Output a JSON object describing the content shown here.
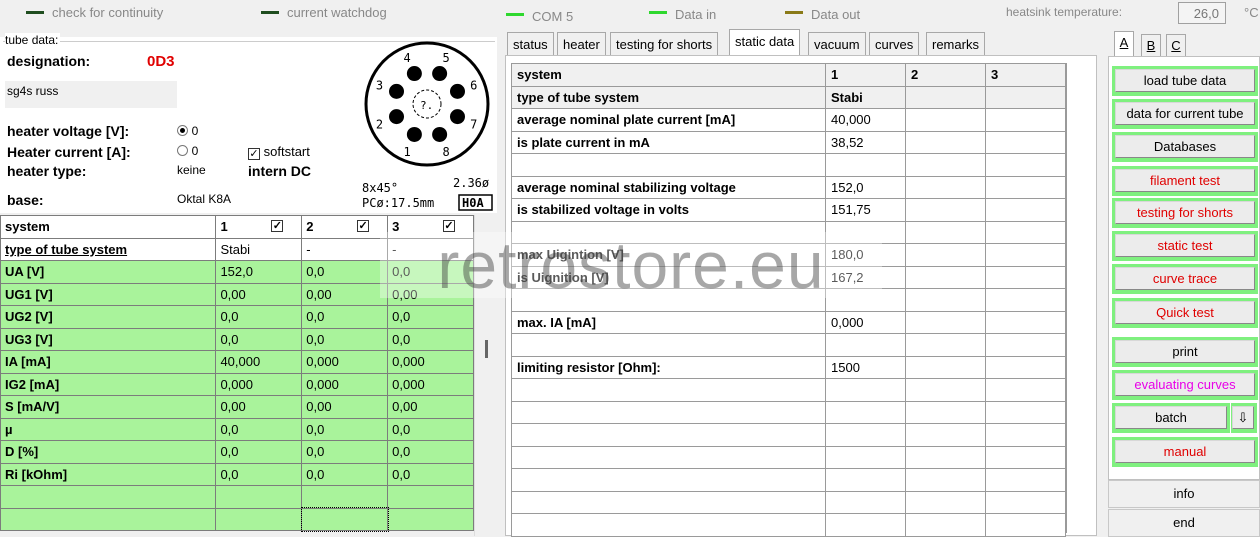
{
  "statusbar": {
    "continuity": {
      "label": "check for continuity",
      "color": "#1f4d1f"
    },
    "watchdog": {
      "label": "current watchdog",
      "color": "#1f4d1f"
    },
    "com": {
      "label": "COM 5",
      "color": "#2ed82e"
    },
    "data_in": {
      "label": "Data in",
      "color": "#2ed82e"
    },
    "data_out": {
      "label": "Data out",
      "color": "#8a7a18"
    },
    "heatsink_label": "heatsink temperature:",
    "heatsink_value": "26,0",
    "heatsink_unit": "°C"
  },
  "tube": {
    "group_label": "tube data:",
    "designation_label": "designation:",
    "designation": "0D3",
    "note": "sg4s russ",
    "heater_voltage_label": "heater voltage [V]:",
    "heater_voltage": "0",
    "heater_current_label": "Heater current [A]:",
    "heater_current": "0",
    "heater_type_label": "heater type:",
    "heater_type": "keine",
    "softstart_label": "softstart",
    "heater_mode": "intern DC",
    "base_label": "base:",
    "base": "Oktal K8A",
    "diagram": {
      "pins": [
        "1",
        "2",
        "3",
        "4",
        "5",
        "6",
        "7",
        "8"
      ],
      "center": "?.",
      "left_note": "8x45°",
      "right_note": "2.36ø",
      "pc_note": "PCø:17.5mm",
      "code": "H0A"
    }
  },
  "left_grid": {
    "headers": [
      "system",
      "1",
      "2",
      "3"
    ],
    "type_row": [
      "type of tube system",
      "Stabi",
      "-",
      "-"
    ],
    "rows": [
      [
        "UA [V]",
        "152,0",
        "0,0",
        "0,0"
      ],
      [
        "UG1 [V]",
        "0,00",
        "0,00",
        "0,00"
      ],
      [
        "UG2 [V]",
        "0,0",
        "0,0",
        "0,0"
      ],
      [
        "UG3 [V]",
        "0,0",
        "0,0",
        "0,0"
      ],
      [
        "IA [mA]",
        "40,000",
        "0,000",
        "0,000"
      ],
      [
        "IG2 [mA]",
        "0,000",
        "0,000",
        "0,000"
      ],
      [
        "S [mA/V]",
        "0,00",
        "0,00",
        "0,00"
      ],
      [
        "µ",
        "0,0",
        "0,0",
        "0,0"
      ],
      [
        "D [%]",
        "0,0",
        "0,0",
        "0,0"
      ],
      [
        "Ri [kOhm]",
        "0,0",
        "0,0",
        "0,0"
      ],
      [
        "",
        "",
        "",
        ""
      ],
      [
        "",
        "",
        "",
        ""
      ]
    ]
  },
  "tabs": [
    "status",
    "heater",
    "testing for shorts",
    "static data",
    "vacuum",
    "curves",
    "remarks"
  ],
  "active_tab": "static data",
  "static_grid": {
    "headers": [
      "system",
      "1",
      "2",
      "3"
    ],
    "type_row": [
      "type of tube system",
      "Stabi",
      "",
      ""
    ],
    "rows": [
      [
        "average nominal plate current [mA]",
        "40,000",
        "",
        ""
      ],
      [
        "is plate current in mA",
        "38,52",
        "",
        ""
      ],
      [
        "",
        "",
        "",
        ""
      ],
      [
        "average nominal stabilizing voltage",
        "152,0",
        "",
        ""
      ],
      [
        "is stabilized voltage in volts",
        "151,75",
        "",
        ""
      ],
      [
        "",
        "",
        "",
        ""
      ],
      [
        "max Uigintion [V]",
        "180,0",
        "",
        ""
      ],
      [
        "is Uignition [V]",
        "167,2",
        "",
        ""
      ],
      [
        "",
        "",
        "",
        ""
      ],
      [
        "max. IA [mA]",
        "0,000",
        "",
        ""
      ],
      [
        "",
        "",
        "",
        ""
      ],
      [
        "limiting resistor [Ohm]:",
        "1500",
        "",
        ""
      ],
      [
        "",
        "",
        "",
        ""
      ],
      [
        "",
        "",
        "",
        ""
      ],
      [
        "",
        "",
        "",
        ""
      ],
      [
        "",
        "",
        "",
        ""
      ],
      [
        "",
        "",
        "",
        ""
      ],
      [
        "",
        "",
        "",
        ""
      ],
      [
        "",
        "",
        "",
        ""
      ]
    ]
  },
  "watermark": "retrostore.eu",
  "right_tabs": [
    "A",
    "B",
    "C"
  ],
  "buttons": {
    "load_tube_data": "load tube data",
    "data_for_current_tube": "data for current tube",
    "databases": "Databases",
    "filament_test": "filament test",
    "testing_for_shorts": "testing for shorts",
    "static_test": "static test",
    "curve_trace": "curve trace",
    "quick_test": "Quick test",
    "print": "print",
    "evaluating_curves": "evaluating curves",
    "batch": "batch",
    "batch_arrow": "⇩",
    "manual": "manual",
    "info": "info",
    "end": "end"
  }
}
